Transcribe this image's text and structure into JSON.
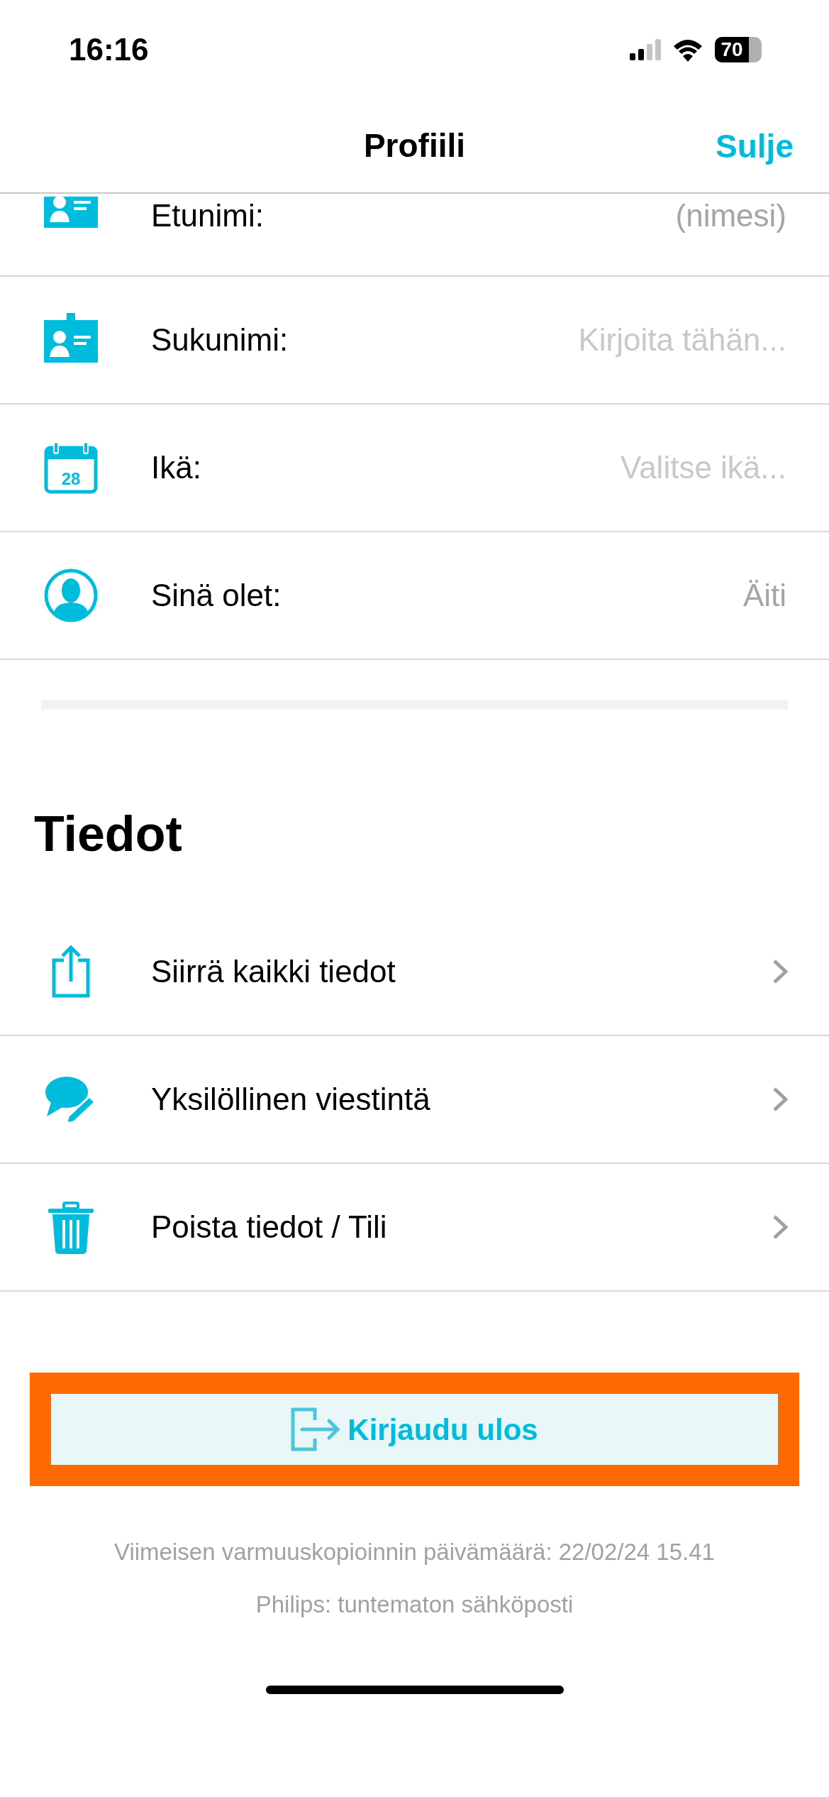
{
  "status_bar": {
    "time": "16:16",
    "battery": "70"
  },
  "nav": {
    "title": "Profiili",
    "close": "Sulje"
  },
  "profile_fields": [
    {
      "kind": "id-card",
      "label": "Etunimi:",
      "value": "(nimesi)"
    },
    {
      "kind": "id-card",
      "label": "Sukunimi:",
      "placeholder": "Kirjoita tähän..."
    },
    {
      "kind": "calendar",
      "icon_text": "28",
      "label": "Ikä:",
      "placeholder": "Valitse ikä..."
    },
    {
      "kind": "person",
      "label": "Sinä olet:",
      "value": "Äiti"
    }
  ],
  "section_title": "Tiedot",
  "data_items": [
    {
      "kind": "share",
      "label": "Siirrä kaikki tiedot"
    },
    {
      "kind": "chat",
      "label": "Yksilöllinen viestintä"
    },
    {
      "kind": "trash",
      "label": "Poista tiedot / Tili"
    }
  ],
  "logout": {
    "label": "Kirjaudu ulos",
    "highlighted": true
  },
  "footer": [
    "Viimeisen varmuuskopioinnin päivämäärä: 22/02/24 15.41",
    "Philips: tuntematon sähköposti"
  ]
}
